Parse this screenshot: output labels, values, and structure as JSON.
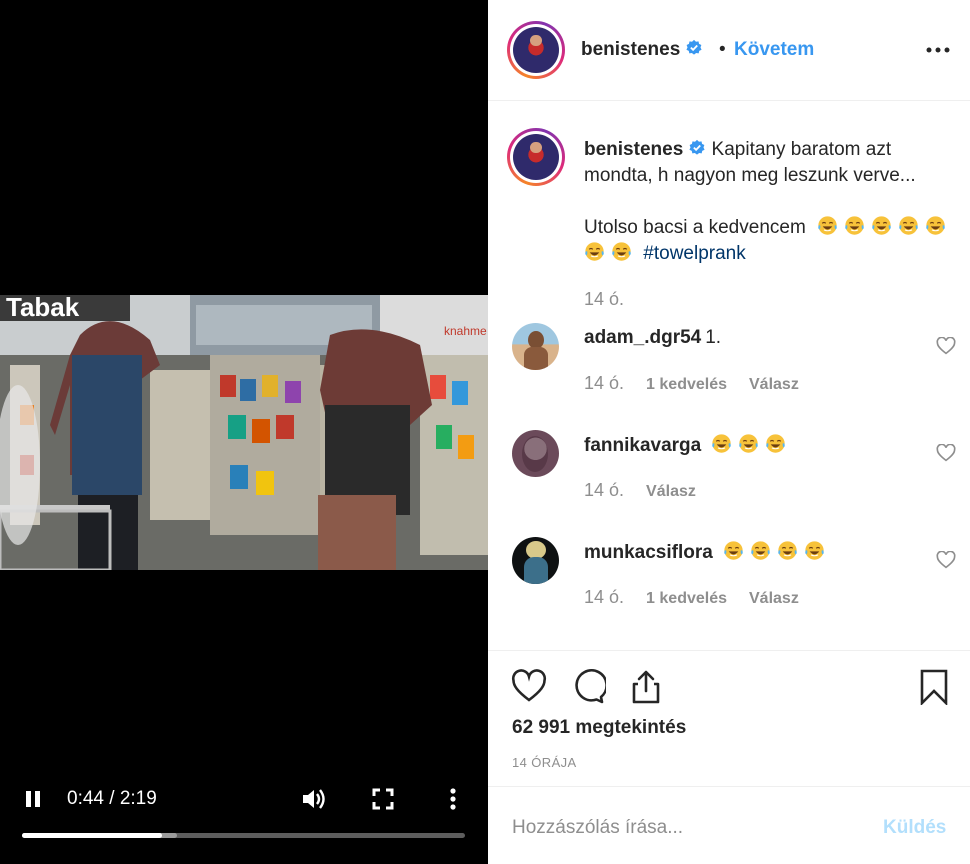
{
  "video": {
    "current_time": "0:44",
    "duration": "2:19",
    "time_display": "0:44 / 2:19",
    "progress_fraction": 0.316,
    "buffered_fraction": 0.35,
    "scene_sign_text": "Tabak",
    "scene_sign_text_2": "knahme",
    "icons": {
      "pause": "pause-icon",
      "volume": "volume-icon",
      "fullscreen": "fullscreen-icon",
      "more": "more-vertical-icon"
    }
  },
  "header": {
    "username": "benistenes",
    "separator": "•",
    "follow_label": "Követem",
    "more_icon": "more-horizontal-icon"
  },
  "caption": {
    "username": "benistenes",
    "text_line1": "Kapitany baratom azt mondta, h nagyon meg leszunk verve...",
    "text_line2": "Utolso bacsi a kedvencem",
    "emoji_count": 7,
    "hashtag": "#towelprank",
    "time": "14 ó."
  },
  "comments": [
    {
      "username": "adam_.dgr54",
      "text": "1.",
      "emoji_count": 0,
      "time": "14 ó.",
      "likes": "1 kedvelés",
      "reply": "Válasz"
    },
    {
      "username": "fannikavarga",
      "text": "",
      "emoji_count": 3,
      "time": "14 ó.",
      "likes": "",
      "reply": "Válasz"
    },
    {
      "username": "munkacsiflora",
      "text": "",
      "emoji_count": 4,
      "time": "14 ó.",
      "likes": "1 kedvelés",
      "reply": "Válasz"
    }
  ],
  "actions": {
    "views": "62 991 megtekintés",
    "posted": "14 ÓRÁJA"
  },
  "compose": {
    "placeholder": "Hozzászólás írása...",
    "send_label": "Küldés"
  },
  "colors": {
    "link_blue": "#3897f0",
    "hashtag_blue": "#003569",
    "secondary_text": "#8e8e8e",
    "send_disabled": "#b2dffc",
    "verified_blue": "#3897f0"
  }
}
